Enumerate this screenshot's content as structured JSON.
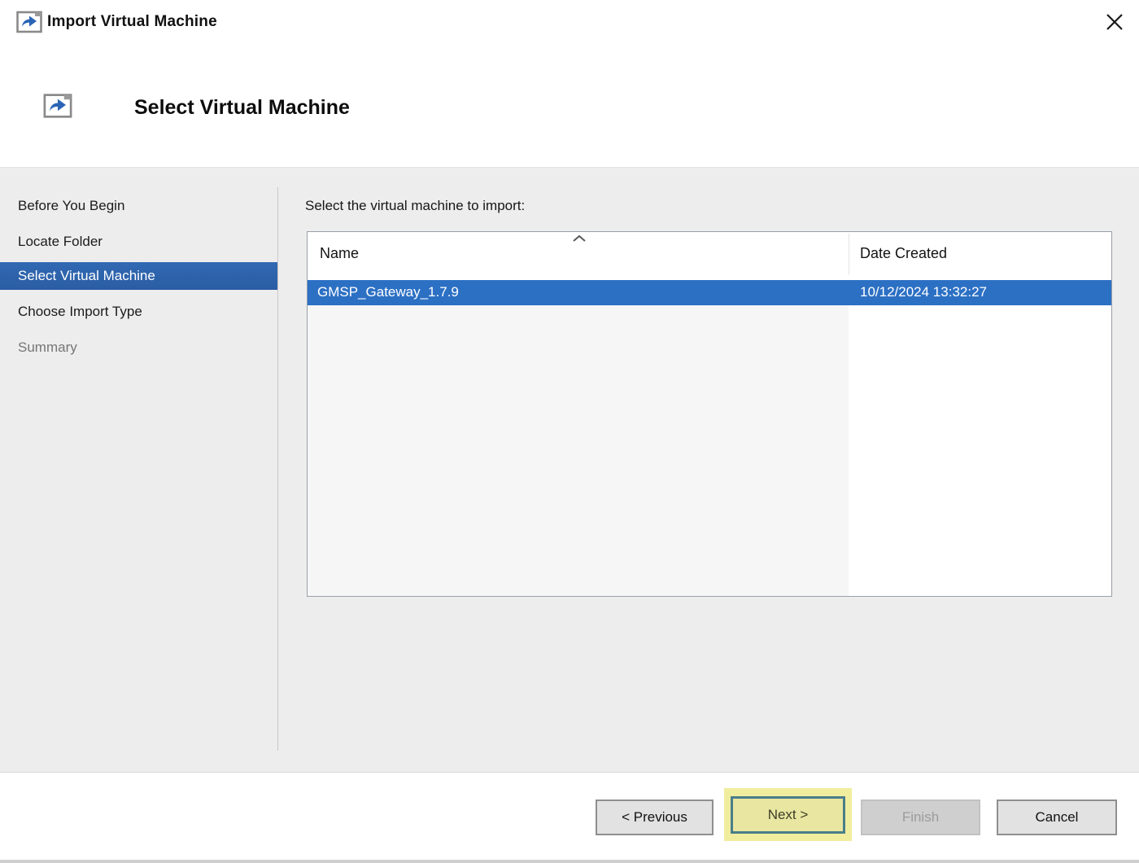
{
  "window": {
    "title": "Import Virtual Machine"
  },
  "header": {
    "title": "Select Virtual Machine"
  },
  "sidebar": {
    "items": [
      {
        "label": "Before You Begin",
        "state": "normal"
      },
      {
        "label": "Locate Folder",
        "state": "normal"
      },
      {
        "label": "Select Virtual Machine",
        "state": "selected"
      },
      {
        "label": "Choose Import Type",
        "state": "normal"
      },
      {
        "label": "Summary",
        "state": "upcoming"
      }
    ]
  },
  "main": {
    "instruction": "Select the virtual machine to import:",
    "table": {
      "columns": [
        "Name",
        "Date Created"
      ],
      "sort": {
        "column": "Name",
        "direction": "ascending"
      },
      "rows": [
        {
          "name": "GMSP_Gateway_1.7.9",
          "date_created": "10/12/2024 13:32:27",
          "selected": true
        }
      ]
    }
  },
  "footer": {
    "buttons": [
      {
        "label": "< Previous",
        "state": "enabled"
      },
      {
        "label": "Next >",
        "state": "highlighted"
      },
      {
        "label": "Finish",
        "state": "disabled"
      },
      {
        "label": "Cancel",
        "state": "enabled"
      }
    ]
  },
  "colors": {
    "selected_nav_bg": "#2d63ae",
    "selected_row_bg": "#2c70c4",
    "highlight_yellow": "#f0ed9f",
    "highlight_border": "#4a7e8a",
    "content_bg": "#ededed"
  }
}
